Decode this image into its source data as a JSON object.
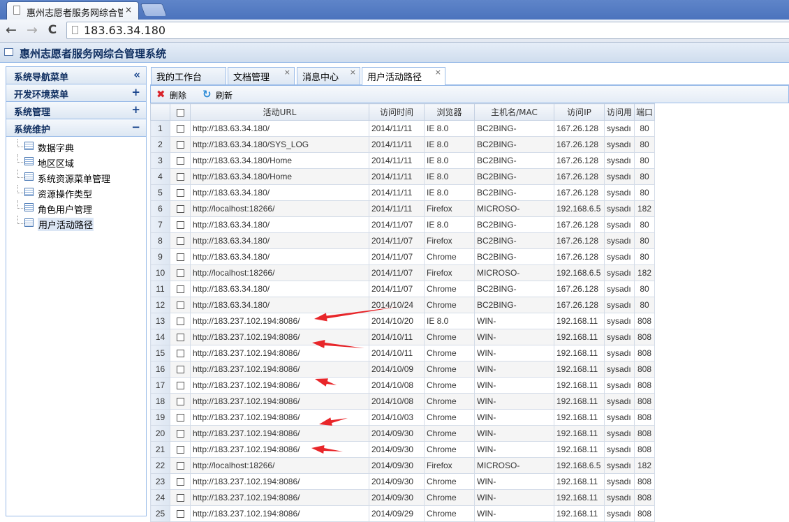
{
  "browser": {
    "tab_title": "惠州志愿者服务网综合管理",
    "tab_close": "×",
    "url": "183.63.34.180",
    "back": "←",
    "forward": "→",
    "reload": "C"
  },
  "app": {
    "title": "惠州志愿者服务网综合管理系统"
  },
  "sidebar": {
    "sections": [
      {
        "label": "系统导航菜单",
        "toggle": "«"
      },
      {
        "label": "开发环境菜单",
        "toggle": "+"
      },
      {
        "label": "系统管理",
        "toggle": "+"
      },
      {
        "label": "系统维护",
        "toggle": "−"
      }
    ],
    "items": [
      {
        "label": "数据字典"
      },
      {
        "label": "地区区域"
      },
      {
        "label": "系统资源菜单管理"
      },
      {
        "label": "资源操作类型"
      },
      {
        "label": "角色用户管理"
      },
      {
        "label": "用户活动路径"
      }
    ]
  },
  "tabs": [
    {
      "label": "我的工作台",
      "close": ""
    },
    {
      "label": "文档管理",
      "close": "×"
    },
    {
      "label": "消息中心",
      "close": "×"
    },
    {
      "label": "用户活动路径",
      "close": "×"
    }
  ],
  "toolbar": {
    "delete_label": "删除",
    "delete_icon": "✖",
    "refresh_label": "刷新",
    "refresh_icon": "↻"
  },
  "grid": {
    "columns": [
      "活动URL",
      "访问时间",
      "浏览器",
      "主机名/MAC",
      "访问IP",
      "访问用",
      "端口"
    ],
    "rows": [
      {
        "n": "1",
        "url": "http://183.63.34.180/",
        "time": "2014/11/11",
        "browser": "IE 8.0",
        "host": "BC2BING-",
        "ip": "167.26.128",
        "user": "sysadı",
        "port": "80"
      },
      {
        "n": "2",
        "url": "http://183.63.34.180/SYS_LOG",
        "time": "2014/11/11",
        "browser": "IE 8.0",
        "host": "BC2BING-",
        "ip": "167.26.128",
        "user": "sysadı",
        "port": "80"
      },
      {
        "n": "3",
        "url": "http://183.63.34.180/Home",
        "time": "2014/11/11",
        "browser": "IE 8.0",
        "host": "BC2BING-",
        "ip": "167.26.128",
        "user": "sysadı",
        "port": "80"
      },
      {
        "n": "4",
        "url": "http://183.63.34.180/Home",
        "time": "2014/11/11",
        "browser": "IE 8.0",
        "host": "BC2BING-",
        "ip": "167.26.128",
        "user": "sysadı",
        "port": "80"
      },
      {
        "n": "5",
        "url": "http://183.63.34.180/",
        "time": "2014/11/11",
        "browser": "IE 8.0",
        "host": "BC2BING-",
        "ip": "167.26.128",
        "user": "sysadı",
        "port": "80"
      },
      {
        "n": "6",
        "url": "http://localhost:18266/",
        "time": "2014/11/11",
        "browser": "Firefox",
        "host": "MICROSO-",
        "ip": "192.168.6.5",
        "user": "sysadı",
        "port": "182"
      },
      {
        "n": "7",
        "url": "http://183.63.34.180/",
        "time": "2014/11/07",
        "browser": "IE 8.0",
        "host": "BC2BING-",
        "ip": "167.26.128",
        "user": "sysadı",
        "port": "80"
      },
      {
        "n": "8",
        "url": "http://183.63.34.180/",
        "time": "2014/11/07",
        "browser": "Firefox",
        "host": "BC2BING-",
        "ip": "167.26.128",
        "user": "sysadı",
        "port": "80"
      },
      {
        "n": "9",
        "url": "http://183.63.34.180/",
        "time": "2014/11/07",
        "browser": "Chrome",
        "host": "BC2BING-",
        "ip": "167.26.128",
        "user": "sysadı",
        "port": "80"
      },
      {
        "n": "10",
        "url": "http://localhost:18266/",
        "time": "2014/11/07",
        "browser": "Firefox",
        "host": "MICROSO-",
        "ip": "192.168.6.5",
        "user": "sysadı",
        "port": "182"
      },
      {
        "n": "11",
        "url": "http://183.63.34.180/",
        "time": "2014/11/07",
        "browser": "Chrome",
        "host": "BC2BING-",
        "ip": "167.26.128",
        "user": "sysadı",
        "port": "80"
      },
      {
        "n": "12",
        "url": "http://183.63.34.180/",
        "time": "2014/10/24",
        "browser": "Chrome",
        "host": "BC2BING-",
        "ip": "167.26.128",
        "user": "sysadı",
        "port": "80"
      },
      {
        "n": "13",
        "url": "http://183.237.102.194:8086/",
        "time": "2014/10/20",
        "browser": "IE 8.0",
        "host": "WIN-",
        "ip": "192.168.11",
        "user": "sysadı",
        "port": "808"
      },
      {
        "n": "14",
        "url": "http://183.237.102.194:8086/",
        "time": "2014/10/11",
        "browser": "Chrome",
        "host": "WIN-",
        "ip": "192.168.11",
        "user": "sysadı",
        "port": "808"
      },
      {
        "n": "15",
        "url": "http://183.237.102.194:8086/",
        "time": "2014/10/11",
        "browser": "Chrome",
        "host": "WIN-",
        "ip": "192.168.11",
        "user": "sysadı",
        "port": "808"
      },
      {
        "n": "16",
        "url": "http://183.237.102.194:8086/",
        "time": "2014/10/09",
        "browser": "Chrome",
        "host": "WIN-",
        "ip": "192.168.11",
        "user": "sysadı",
        "port": "808"
      },
      {
        "n": "17",
        "url": "http://183.237.102.194:8086/",
        "time": "2014/10/08",
        "browser": "Chrome",
        "host": "WIN-",
        "ip": "192.168.11",
        "user": "sysadı",
        "port": "808"
      },
      {
        "n": "18",
        "url": "http://183.237.102.194:8086/",
        "time": "2014/10/08",
        "browser": "Chrome",
        "host": "WIN-",
        "ip": "192.168.11",
        "user": "sysadı",
        "port": "808"
      },
      {
        "n": "19",
        "url": "http://183.237.102.194:8086/",
        "time": "2014/10/03",
        "browser": "Chrome",
        "host": "WIN-",
        "ip": "192.168.11",
        "user": "sysadı",
        "port": "808"
      },
      {
        "n": "20",
        "url": "http://183.237.102.194:8086/",
        "time": "2014/09/30",
        "browser": "Chrome",
        "host": "WIN-",
        "ip": "192.168.11",
        "user": "sysadı",
        "port": "808"
      },
      {
        "n": "21",
        "url": "http://183.237.102.194:8086/",
        "time": "2014/09/30",
        "browser": "Chrome",
        "host": "WIN-",
        "ip": "192.168.11",
        "user": "sysadı",
        "port": "808"
      },
      {
        "n": "22",
        "url": "http://localhost:18266/",
        "time": "2014/09/30",
        "browser": "Firefox",
        "host": "MICROSO-",
        "ip": "192.168.6.5",
        "user": "sysadı",
        "port": "182"
      },
      {
        "n": "23",
        "url": "http://183.237.102.194:8086/",
        "time": "2014/09/30",
        "browser": "Chrome",
        "host": "WIN-",
        "ip": "192.168.11",
        "user": "sysadı",
        "port": "808"
      },
      {
        "n": "24",
        "url": "http://183.237.102.194:8086/",
        "time": "2014/09/30",
        "browser": "Chrome",
        "host": "WIN-",
        "ip": "192.168.11",
        "user": "sysadı",
        "port": "808"
      },
      {
        "n": "25",
        "url": "http://183.237.102.194:8086/",
        "time": "2014/09/29",
        "browser": "Chrome",
        "host": "WIN-",
        "ip": "192.168.11",
        "user": "sysadı",
        "port": "808"
      }
    ]
  },
  "colors": {
    "annotation_arrow": "#e8262a",
    "header_blue": "#99bbe8",
    "title_blue": "#0e2d5f"
  }
}
